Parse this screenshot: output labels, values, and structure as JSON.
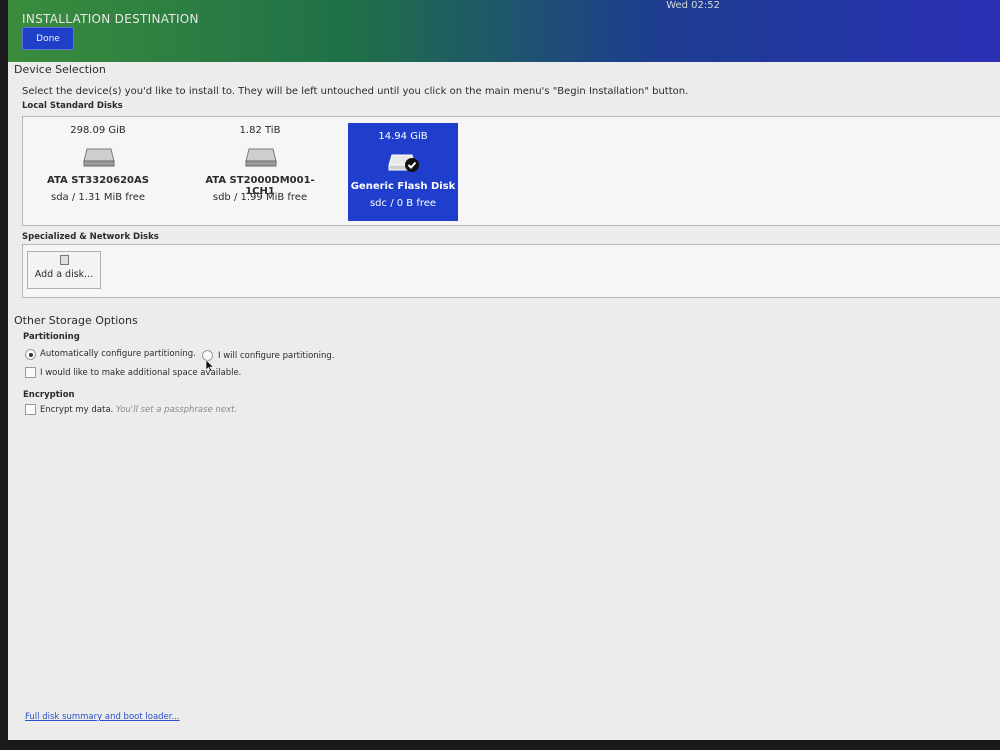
{
  "header": {
    "title": "INSTALLATION DESTINATION",
    "done_label": "Done",
    "clock": "Wed 02:52"
  },
  "device_selection": {
    "title": "Device Selection",
    "instructions": "Select the device(s) you'd like to install to.  They will be left untouched until you click on the main menu's \"Begin Installation\" button.",
    "local_disks_title": "Local Standard Disks",
    "disks": [
      {
        "size": "298.09 GiB",
        "name": "ATA ST3320620AS",
        "info": "sda  /  1.31 MiB free",
        "selected": false,
        "icon": "hard-disk-icon"
      },
      {
        "size": "1.82 TiB",
        "name": "ATA ST2000DM001-1CH1",
        "info": "sdb   /   1.99 MiB free",
        "selected": false,
        "icon": "hard-disk-icon"
      },
      {
        "size": "14.94 GiB",
        "name": "Generic Flash Disk",
        "info": "sdc   /   0 B free",
        "selected": true,
        "icon": "flash-disk-check-icon"
      }
    ],
    "network_disks_title": "Specialized & Network Disks",
    "add_disk_label": "Add a disk..."
  },
  "other_storage": {
    "title": "Other Storage Options",
    "partitioning_title": "Partitioning",
    "auto_partition_label": "Automatically configure partitioning.",
    "manual_partition_label": "I will configure partitioning.",
    "auto_partition_selected": true,
    "additional_space_label": "I would like to make additional space available.",
    "encryption_title": "Encryption",
    "encrypt_label": "Encrypt my data.",
    "encrypt_hint": "You'll set a passphrase next."
  },
  "footer": {
    "summary_link": "Full disk summary and boot loader..."
  },
  "colors": {
    "selected_disk": "#1f3ecc",
    "done_button": "#1e3fc8",
    "link": "#2b4fcc"
  }
}
